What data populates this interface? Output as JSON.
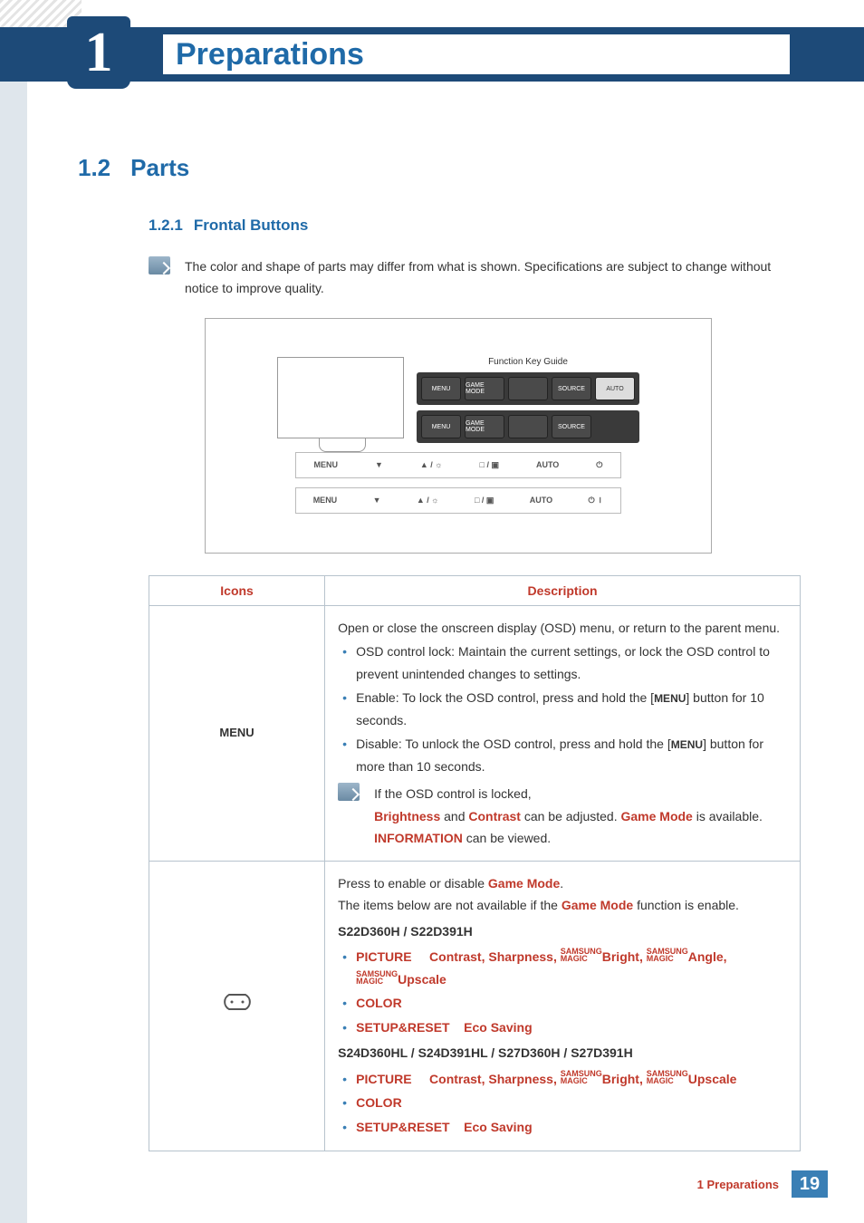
{
  "chapter": {
    "number": "1",
    "title": "Preparations"
  },
  "section": {
    "number": "1.2",
    "title": "Parts"
  },
  "subsection": {
    "number": "1.2.1",
    "title": "Frontal Buttons"
  },
  "note": "The color and shape of parts may differ from what is shown. Specifications are subject to change without notice to improve quality.",
  "diagram": {
    "fkg_label": "Function Key Guide",
    "osd_row1": [
      "MENU",
      "GAME MODE",
      "",
      "SOURCE",
      "AUTO"
    ],
    "osd_row2": [
      "MENU",
      "GAME MODE",
      "",
      "SOURCE"
    ],
    "phys_row1": [
      "MENU",
      "▼",
      "▲ / ☼",
      "□ / ▣",
      "AUTO",
      "⏻"
    ],
    "phys_row2": [
      "MENU",
      "▼",
      "▲ / ☼",
      "□ / ▣",
      "AUTO",
      "⏻ ⏽"
    ]
  },
  "table": {
    "headers": {
      "icons": "Icons",
      "description": "Description"
    },
    "rows": [
      {
        "icon": "MENU",
        "desc": {
          "intro": "Open or close the onscreen display (OSD) menu, or return to the parent menu.",
          "bullets": [
            "OSD control lock: Maintain the current settings, or lock the OSD control to prevent unintended changes to settings.",
            {
              "pre": "Enable: To lock the OSD control, press and hold the [",
              "btn": "MENU",
              "post": "] button for 10 seconds."
            },
            {
              "pre": "Disable: To unlock the OSD control, press and hold the [",
              "btn": "MENU",
              "post": "] button for more than 10 seconds."
            }
          ],
          "note_lead": "If the OSD control is locked,",
          "note_body_parts": {
            "p1": "Brightness",
            "p2": " and ",
            "p3": "Contrast",
            "p4": " can be adjusted. ",
            "p5": "Game Mode",
            "p6": " is available. ",
            "p7": "INFORMATION",
            "p8": " can be viewed."
          }
        }
      },
      {
        "icon": "gamepad",
        "desc": {
          "line1_pre": "Press to enable or disable ",
          "line1_kw": "Game Mode",
          "line1_post": ".",
          "line2_pre": "The items below are not available if the ",
          "line2_kw": "Game Mode",
          "line2_post": " function is enable.",
          "model_a": "S22D360H / S22D391H",
          "a_bullets": {
            "b1": {
              "head": "PICTURE",
              "items": "Contrast, Sharpness, ",
              "m1": "Bright, ",
              "m2": "Angle, ",
              "tail": "Upscale"
            },
            "b2": "COLOR",
            "b3": {
              "head": "SETUP&RESET",
              "item": "Eco Saving"
            }
          },
          "model_b": "S24D360HL / S24D391HL / S27D360H / S27D391H",
          "b_bullets": {
            "b1": {
              "head": "PICTURE",
              "items": "Contrast, Sharpness, ",
              "m1": "Bright, ",
              "tail": "Upscale"
            },
            "b2": "COLOR",
            "b3": {
              "head": "SETUP&RESET",
              "item": "Eco Saving"
            }
          }
        }
      }
    ]
  },
  "magic": {
    "top": "SAMSUNG",
    "bot": "MAGIC"
  },
  "footer": {
    "label": "1 Preparations",
    "page": "19"
  }
}
